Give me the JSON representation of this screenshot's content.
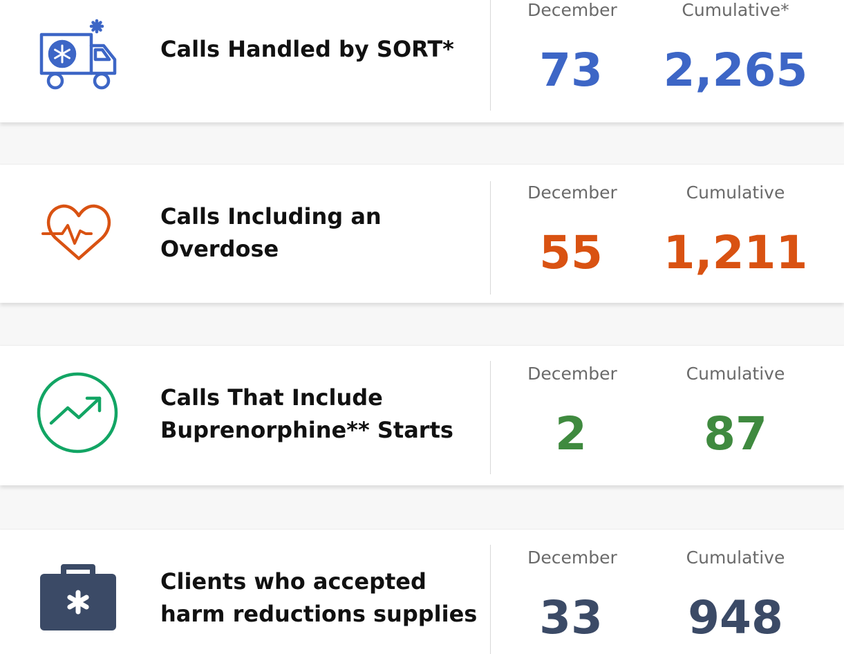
{
  "colors": {
    "blue": "#3d66c6",
    "orange": "#d95212",
    "green": "#3f8a3f",
    "green_icon": "#12a564",
    "slate": "#3b4a66",
    "label_gray": "#6a6a6a"
  },
  "stats": [
    {
      "icon": "ambulance-icon",
      "title": "Calls Handled by SORT*",
      "month_label": "December",
      "month_value": "73",
      "cumulative_label": "Cumulative*",
      "cumulative_value": "2,265"
    },
    {
      "icon": "heartbeat-icon",
      "title": "Calls Including an\nOverdose",
      "month_label": "December",
      "month_value": "55",
      "cumulative_label": "Cumulative",
      "cumulative_value": "1,211"
    },
    {
      "icon": "trend-up-icon",
      "title": "Calls That Include\nBuprenorphine** Starts",
      "month_label": "December",
      "month_value": "2",
      "cumulative_label": "Cumulative",
      "cumulative_value": "87"
    },
    {
      "icon": "medical-kit-icon",
      "title": "Clients who accepted\nharm reductions supplies",
      "month_label": "December",
      "month_value": "33",
      "cumulative_label": "Cumulative",
      "cumulative_value": "948"
    }
  ]
}
